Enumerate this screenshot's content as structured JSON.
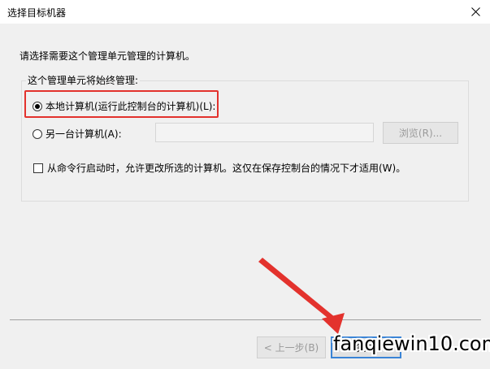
{
  "window": {
    "title": "选择目标机器",
    "close_icon": "close-icon"
  },
  "prompt": "请选择需要这个管理单元管理的计算机。",
  "group": {
    "legend": "这个管理单元将始终管理:",
    "local_option_label": "本地计算机(运行此控制台的计算机)(L):",
    "local_selected": true,
    "other_option_label": "另一台计算机(A):",
    "other_selected": false,
    "other_computer_value": "",
    "browse_label": "浏览(R)...",
    "checkbox_label": "从命令行启动时，允许更改所选的计算机。这仅在保存控制台的情况下才适用(W)。",
    "checkbox_checked": false
  },
  "footer": {
    "back_label": "< 上一步(B)",
    "next_label": "完成"
  },
  "watermark": "fanqiewin10.com",
  "colors": {
    "highlight": "#e3322d",
    "default_button_border": "#3a84d6",
    "background": "#f0f0f0"
  }
}
